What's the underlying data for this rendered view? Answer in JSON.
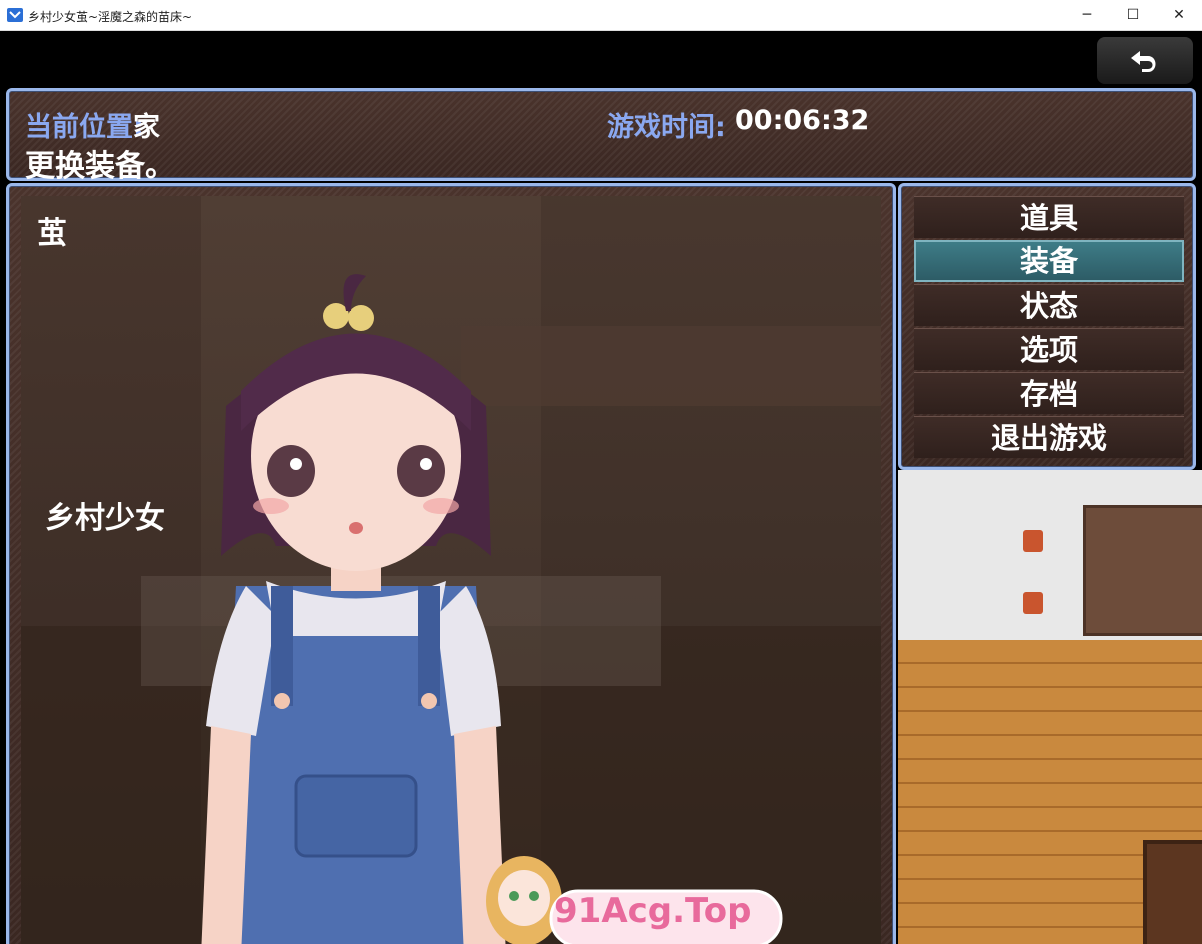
{
  "window": {
    "title": "乡村少女茧~淫魔之森的苗床~",
    "minimize_glyph": "─",
    "maximize_glyph": "☐",
    "close_glyph": "✕"
  },
  "toolbar": {
    "back_icon": "return-arrow-icon"
  },
  "status": {
    "location_label": "当前位置:",
    "location_value": "家",
    "time_label": "游戏时间:",
    "time_value": "00:06:32",
    "help_text": "更换装备。"
  },
  "character": {
    "name": "茧",
    "title": "乡村少女"
  },
  "menu": {
    "items": [
      {
        "label": "道具"
      },
      {
        "label": "装备",
        "selected": true
      },
      {
        "label": "状态"
      },
      {
        "label": "选项"
      },
      {
        "label": "存档"
      },
      {
        "label": "退出游戏"
      }
    ]
  },
  "watermark": {
    "text": "91Acg.Top"
  },
  "colors": {
    "panel_border": "#9ab7ea",
    "label_blue": "#8aa8f0",
    "selected_item": "#3e7c87"
  }
}
